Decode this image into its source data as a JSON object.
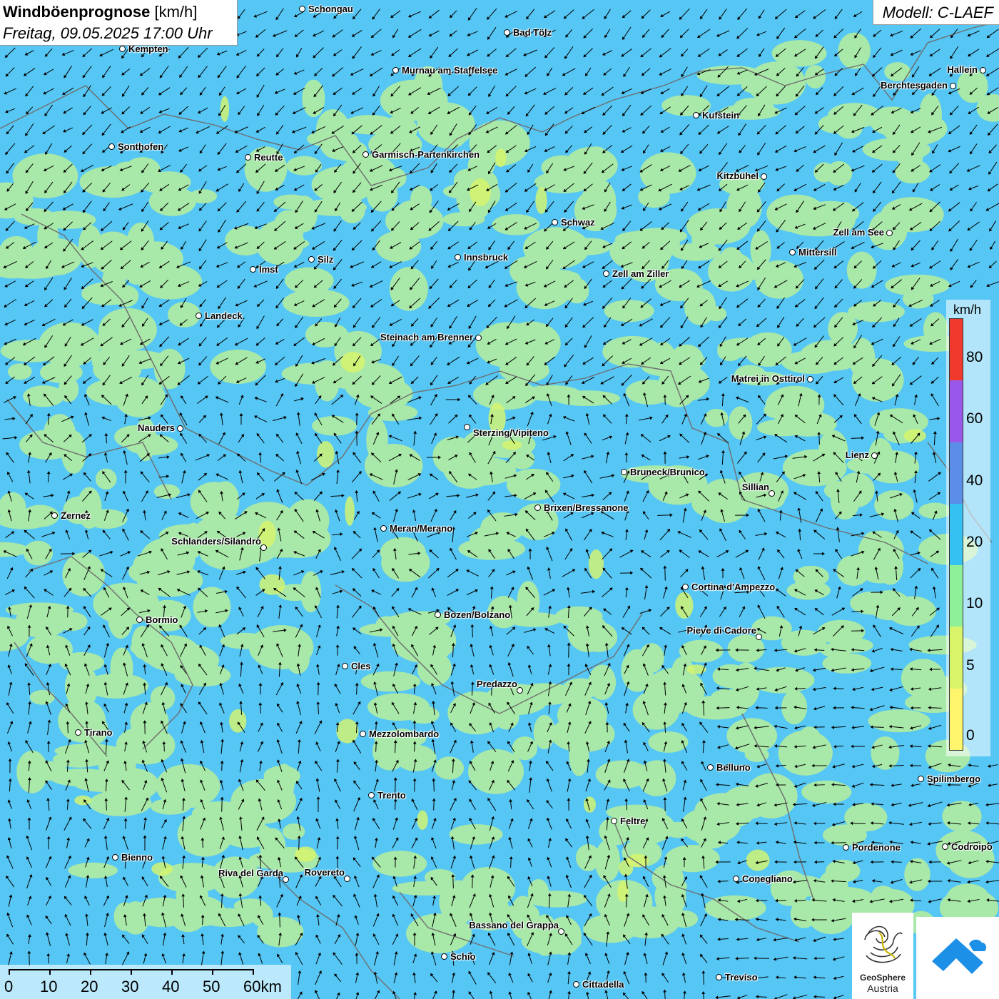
{
  "header": {
    "title": "Windböenprognose",
    "unit": "[km/h]",
    "datetime": "Freitag, 09.05.2025 17:00 Uhr"
  },
  "model_label": "Modell: C-LAEF",
  "legend": {
    "unit": "km/h",
    "ticks": [
      "80",
      "60",
      "40",
      "20",
      "10",
      "5",
      "0"
    ],
    "classes": [
      {
        "from": 80,
        "color": "#f03a2e"
      },
      {
        "from": 60,
        "color": "#9a58ea"
      },
      {
        "from": 40,
        "color": "#5a8ee8"
      },
      {
        "from": 20,
        "color": "#35c2f2"
      },
      {
        "from": 10,
        "color": "#8ff09a"
      },
      {
        "from": 5,
        "color": "#d8f56a"
      },
      {
        "from": 0,
        "color": "#fff66e"
      }
    ]
  },
  "colors": {
    "low_wind": "#a8e8a8",
    "medium_wind": "#56c6f4",
    "borders": "#6e6e6e",
    "arrows": "#000000"
  },
  "cities": [
    {
      "name": "Schongau"
    },
    {
      "name": "Bad Tölz"
    },
    {
      "name": "Kempten"
    },
    {
      "name": "Murnau am Staffelsee"
    },
    {
      "name": "Hallein"
    },
    {
      "name": "Berchtesgaden"
    },
    {
      "name": "Kufstein"
    },
    {
      "name": "Sonthofen"
    },
    {
      "name": "Reutte"
    },
    {
      "name": "Garmisch-Partenkirchen"
    },
    {
      "name": "Kitzbühel"
    },
    {
      "name": "Schwaz"
    },
    {
      "name": "Zell am See"
    },
    {
      "name": "Mittersill"
    },
    {
      "name": "Innsbruck"
    },
    {
      "name": "Silz"
    },
    {
      "name": "Imst"
    },
    {
      "name": "Zell am Ziller"
    },
    {
      "name": "Landeck"
    },
    {
      "name": "Steinach am Brenner"
    },
    {
      "name": "Matrei in Osttirol"
    },
    {
      "name": "Nauders"
    },
    {
      "name": "Sterzing/Vipiteno"
    },
    {
      "name": "Lienz"
    },
    {
      "name": "Bruneck/Brunico"
    },
    {
      "name": "Sillian"
    },
    {
      "name": "Zernez"
    },
    {
      "name": "Brixen/Bressanone"
    },
    {
      "name": "Meran/Merano"
    },
    {
      "name": "Schlanders/Silandro"
    },
    {
      "name": "Cortina d'Ampezzo"
    },
    {
      "name": "Bozen/Bolzano"
    },
    {
      "name": "Bormio"
    },
    {
      "name": "Pieve di Cadore"
    },
    {
      "name": "Cles"
    },
    {
      "name": "Predazzo"
    },
    {
      "name": "Tirano"
    },
    {
      "name": "Mezzolombardo"
    },
    {
      "name": "Belluno"
    },
    {
      "name": "Spilimbergo"
    },
    {
      "name": "Trento"
    },
    {
      "name": "Feltre"
    },
    {
      "name": "Pordenone"
    },
    {
      "name": "Codroipo"
    },
    {
      "name": "Bienno"
    },
    {
      "name": "Riva del Garda"
    },
    {
      "name": "Rovereto"
    },
    {
      "name": "Conegliano"
    },
    {
      "name": "Bassano del Grappa"
    },
    {
      "name": "Schio"
    },
    {
      "name": "Treviso"
    },
    {
      "name": "Cittadella"
    }
  ],
  "scale_bar": {
    "labels": [
      "0",
      "10",
      "20",
      "30",
      "40",
      "50",
      "60km"
    ]
  },
  "logos": {
    "geosphere_line1": "GeoSphere",
    "geosphere_line2": "Austria"
  }
}
